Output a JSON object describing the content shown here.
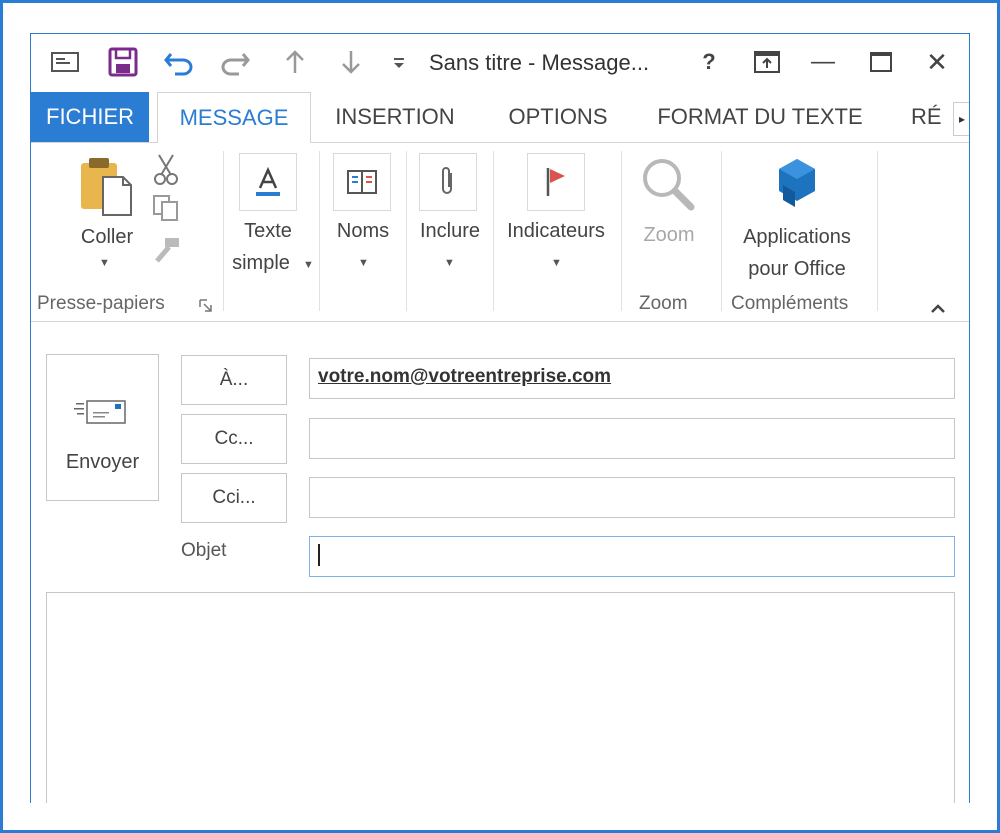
{
  "window": {
    "title": "Sans titre - Message..."
  },
  "title_controls": {
    "help": "?",
    "minimize": "—",
    "close": "✕"
  },
  "tabs": {
    "file": "FICHIER",
    "message": "MESSAGE",
    "insertion": "INSERTION",
    "options": "OPTIONS",
    "format": "FORMAT DU TEXTE",
    "truncated": "RÉ"
  },
  "ribbon": {
    "paste_label": "Coller",
    "clipboard_group": "Presse-papiers",
    "basic_text_line1": "Texte",
    "basic_text_line2": "simple",
    "names_label": "Noms",
    "include_label": "Inclure",
    "flags_label": "Indicateurs",
    "zoom_label": "Zoom",
    "zoom_group": "Zoom",
    "apps_line1": "Applications",
    "apps_line2": "pour Office",
    "addins_group": "Compléments"
  },
  "compose": {
    "send_label": "Envoyer",
    "to_button": "À...",
    "cc_button": "Cc...",
    "bcc_button": "Cci...",
    "to_value": "votre.nom@votreentreprise.com",
    "cc_value": "",
    "bcc_value": "",
    "subject_label": "Objet",
    "subject_value": ""
  },
  "colors": {
    "accent": "#2b7cd3",
    "flag": "#d9534f"
  },
  "icons": [
    "window-icon",
    "save-icon",
    "undo-icon",
    "redo-icon",
    "up-arrow-icon",
    "down-arrow-icon",
    "customize-icon",
    "help-icon",
    "ribbon-display-icon",
    "minimize-icon",
    "maximize-icon",
    "close-icon",
    "paste-icon",
    "cut-icon",
    "copy-icon",
    "format-painter-icon",
    "text-format-icon",
    "address-book-icon",
    "paperclip-icon",
    "flag-icon",
    "magnifier-icon",
    "office-apps-icon",
    "envelope-icon"
  ]
}
